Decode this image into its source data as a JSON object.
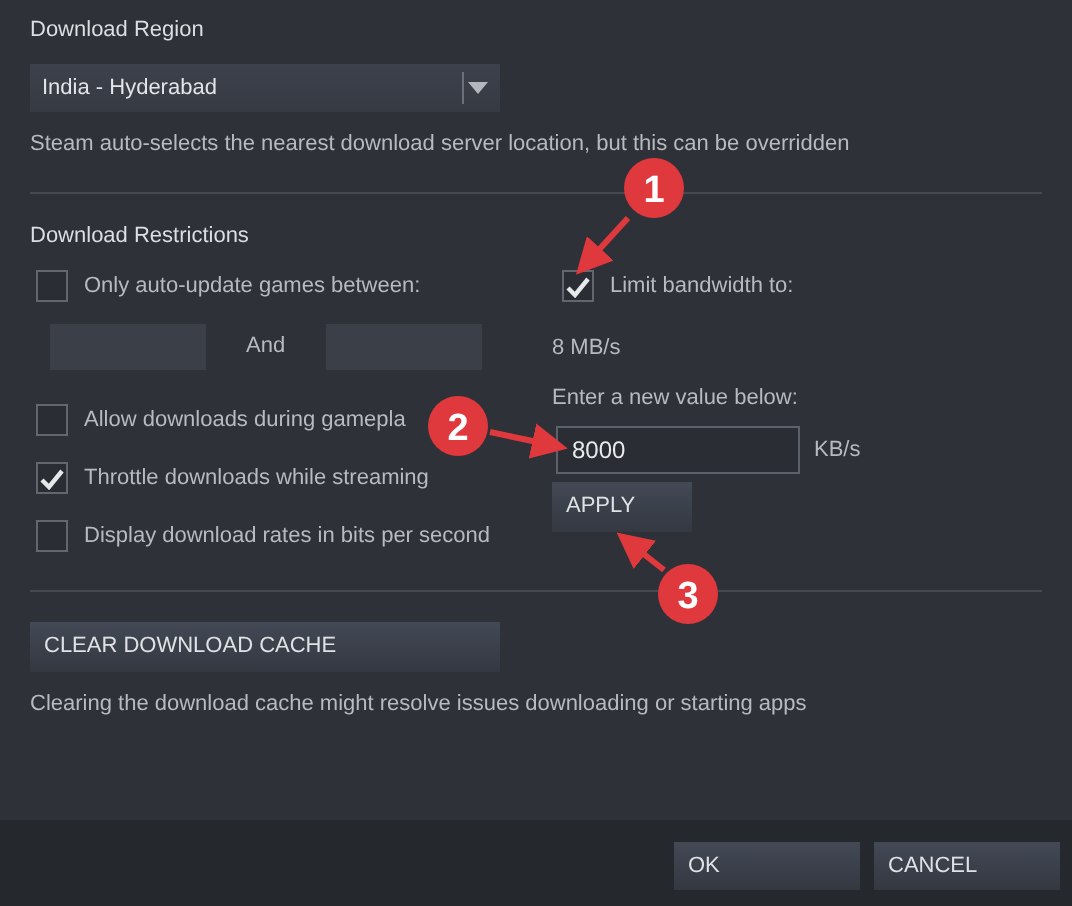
{
  "download_region": {
    "heading": "Download Region",
    "dropdown": {
      "value": "India - Hyderabad"
    },
    "help": "Steam auto-selects the nearest download server location, but this can be overridden"
  },
  "download_restrictions": {
    "heading": "Download Restrictions",
    "auto_update": {
      "label": "Only auto-update games between:",
      "checked": false,
      "and_label": "And"
    },
    "options": [
      {
        "label": "Allow downloads during gamepla",
        "checked": false
      },
      {
        "label": "Throttle downloads while streaming",
        "checked": true
      },
      {
        "label": "Display download rates in bits per second",
        "checked": false
      }
    ],
    "bandwidth": {
      "label": "Limit bandwidth to:",
      "checked": true,
      "current": "8 MB/s",
      "prompt": "Enter a new value below:",
      "value": "8000",
      "unit": "KB/s",
      "apply_button": "APPLY"
    }
  },
  "cache": {
    "button": "CLEAR DOWNLOAD CACHE",
    "help": "Clearing the download cache might resolve issues downloading or starting apps"
  },
  "buttons": [
    "OK",
    "CANCEL"
  ],
  "callouts": [
    {
      "label": "1"
    },
    {
      "label": "2"
    },
    {
      "label": "3"
    }
  ]
}
